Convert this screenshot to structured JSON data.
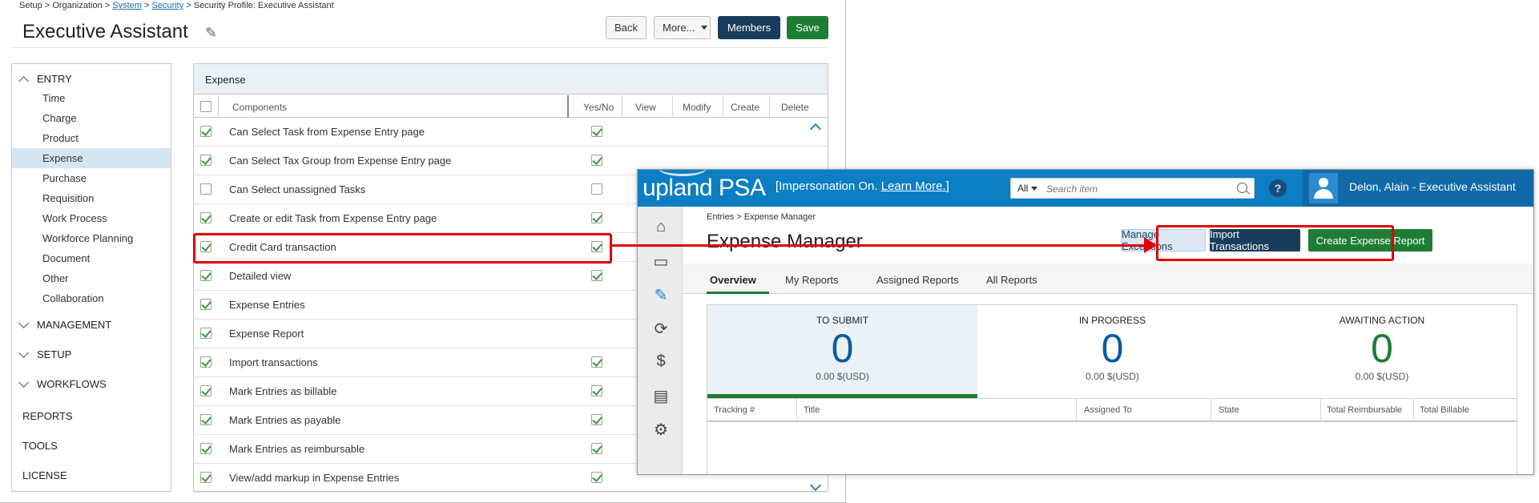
{
  "back": {
    "breadcrumb": {
      "setup": "Setup",
      "org": "Organization",
      "system": "System",
      "security": "Security",
      "profile": "Security Profile: Executive Assistant",
      "sep": ">"
    },
    "title": "Executive Assistant",
    "buttons": {
      "back": "Back",
      "more": "More...",
      "members": "Members",
      "save": "Save"
    },
    "sidebar": {
      "entry": "ENTRY",
      "entry_items": [
        "Time",
        "Charge",
        "Product",
        "Expense",
        "Purchase",
        "Requisition",
        "Work Process",
        "Workforce Planning",
        "Document",
        "Other",
        "Collaboration"
      ],
      "selected": "Expense",
      "management": "MANAGEMENT",
      "setup": "SETUP",
      "workflows": "WORKFLOWS",
      "reports": "REPORTS",
      "tools": "TOOLS",
      "license": "LICENSE"
    },
    "expense": {
      "header": "Expense",
      "columns": {
        "components": "Components",
        "yesno": "Yes/No",
        "view": "View",
        "modify": "Modify",
        "create": "Create",
        "delete": "Delete"
      },
      "rows": [
        {
          "label": "Can Select Task from Expense Entry page",
          "row": true,
          "yesno": true
        },
        {
          "label": "Can Select Tax Group from Expense Entry page",
          "row": true,
          "yesno": true
        },
        {
          "label": "Can Select unassigned Tasks",
          "row": false,
          "yesno": false
        },
        {
          "label": "Create or edit Task from Expense Entry page",
          "row": true,
          "yesno": true
        },
        {
          "label": "Credit Card transaction",
          "row": true,
          "yesno": true
        },
        {
          "label": "Detailed view",
          "row": true,
          "yesno": true
        },
        {
          "label": "Expense Entries",
          "row": true,
          "yesno": null
        },
        {
          "label": "Expense Report",
          "row": true,
          "yesno": null
        },
        {
          "label": "Import transactions",
          "row": true,
          "yesno": true
        },
        {
          "label": "Mark Entries as billable",
          "row": true,
          "yesno": true
        },
        {
          "label": "Mark Entries as payable",
          "row": true,
          "yesno": true
        },
        {
          "label": "Mark Entries as reimbursable",
          "row": true,
          "yesno": true
        },
        {
          "label": "View/add markup in Expense Entries",
          "row": true,
          "yesno": true
        }
      ]
    }
  },
  "front": {
    "logo": "upland PSA",
    "impersonation": "[Impersonation On.",
    "learn_more": "Learn More.",
    "impersonation_end": "]",
    "search": {
      "scope": "All",
      "placeholder": "Search item"
    },
    "help": "?",
    "user": "Delon, Alain - Executive Assistant",
    "breadcrumb": "Entries > Expense Manager",
    "title": "Expense Manager",
    "buttons": {
      "manage": "Manage Exceptions",
      "import": "Import Transactions",
      "create": "Create Expense Report"
    },
    "tabs": [
      "Overview",
      "My Reports",
      "Assigned Reports",
      "All Reports"
    ],
    "summary": [
      {
        "label": "TO SUBMIT",
        "count": "0",
        "amount": "0.00 $(USD)",
        "color": "#0b5a9e"
      },
      {
        "label": "IN PROGRESS",
        "count": "0",
        "amount": "0.00 $(USD)",
        "color": "#0b5a9e"
      },
      {
        "label": "AWAITING ACTION",
        "count": "0",
        "amount": "0.00 $(USD)",
        "color": "#1e7d32"
      }
    ],
    "grid_columns": [
      "Tracking #",
      "Title",
      "Assigned To",
      "State",
      "Total Reimbursable",
      "Total Billable"
    ]
  },
  "colors": {
    "brand_blue": "#0b7ec4",
    "navy": "#183c5c",
    "green": "#1e7d32",
    "annotation_red": "#e00000"
  }
}
